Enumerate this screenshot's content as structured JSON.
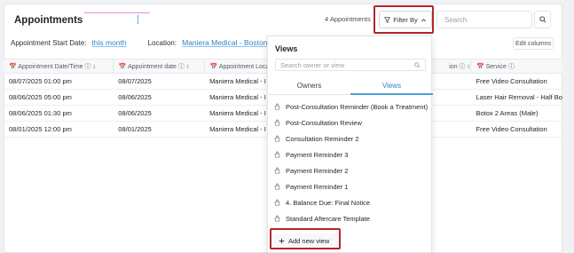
{
  "page": {
    "title": "Appointments"
  },
  "toolbar": {
    "count_text": "4 Appointments",
    "filter_label": "Filter By",
    "search_placeholder": "Search"
  },
  "filters": {
    "start_date_label": "Appointment Start Date:",
    "start_date_value": "this month",
    "location_label": "Location:",
    "location_value": "Maniera Medical - Boston",
    "edit_columns": "Edit columns"
  },
  "table": {
    "headers": [
      "Appointment Date/Time",
      "Appointment date",
      "Appointment Loca",
      "ion",
      "Service"
    ],
    "rows": [
      [
        "08/07/2025 01:00 pm",
        "08/07/2025",
        "Maniera Medical - I",
        "",
        "Free Video Consultation"
      ],
      [
        "08/06/2025 05:00 pm",
        "08/06/2025",
        "Maniera Medical - I",
        "",
        "Laser Hair Removal - Half Bo"
      ],
      [
        "08/06/2025 01:30 pm",
        "08/06/2025",
        "Maniera Medical - I",
        "",
        "Botox 2 Areas (Male)"
      ],
      [
        "08/01/2025 12:00 pm",
        "08/01/2025",
        "Maniera Medical - I",
        "",
        "Free Video Consultation"
      ]
    ]
  },
  "views_dropdown": {
    "heading": "Views",
    "search_placeholder": "Search owner or view",
    "tabs": [
      "Owners",
      "Views"
    ],
    "active_tab": "Views",
    "items": [
      "Post-Consultation Reminder (Book a Treatment)",
      "Post-Consultation Review",
      "Consultation Reminder 2",
      "Payment Reminder 3",
      "Payment Reminder 2",
      "Payment Reminder 1",
      "4. Balance Due: Final Notice",
      "Standard Aftercare Template"
    ],
    "add_new_view": "Add new view"
  },
  "colors": {
    "accent": "#2a86c9",
    "highlight": "#b3262b"
  }
}
